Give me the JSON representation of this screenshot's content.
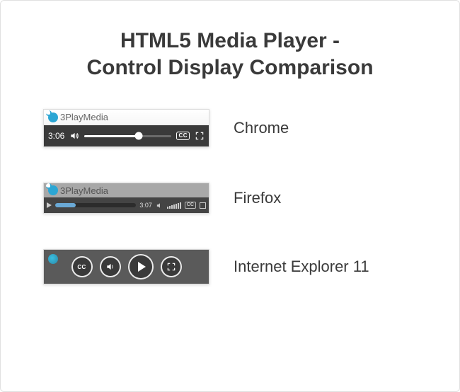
{
  "title": {
    "line1": "HTML5 Media Player -",
    "line2": "Control Display Comparison"
  },
  "brand": {
    "prefix": "3Play",
    "suffix": "Media"
  },
  "cc_label": "CC",
  "players": {
    "chrome": {
      "label": "Chrome",
      "time": "3:06"
    },
    "firefox": {
      "label": "Firefox",
      "time": "3:07"
    },
    "ie": {
      "label": "Internet Explorer 11"
    }
  }
}
